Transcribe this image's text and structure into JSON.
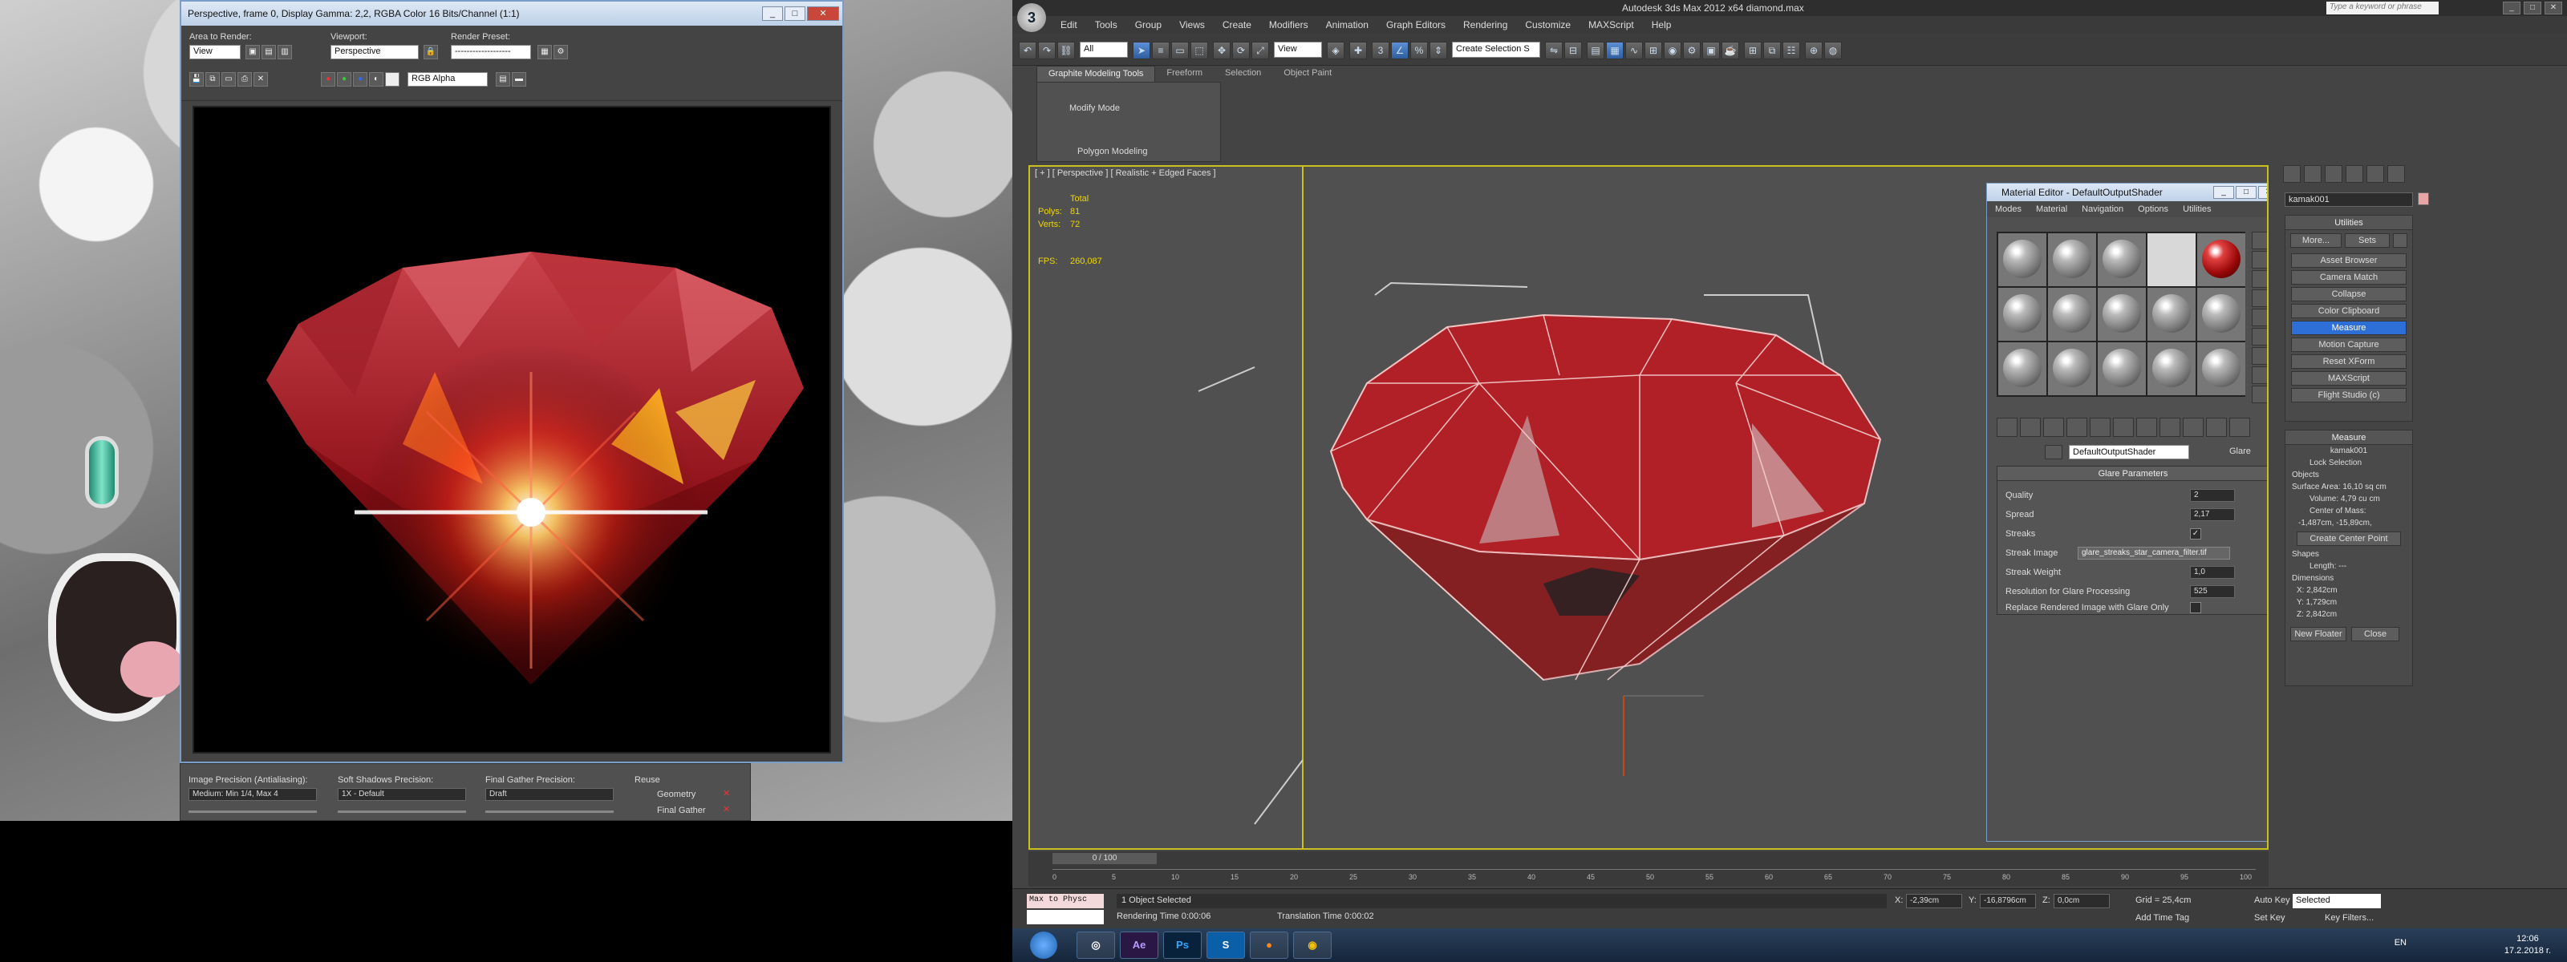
{
  "frame_buffer": {
    "title": "Perspective, frame 0, Display Gamma: 2,2, RGBA Color 16 Bits/Channel (1:1)",
    "area_to_render_label": "Area to Render:",
    "area_to_render_value": "View",
    "viewport_label": "Viewport:",
    "viewport_value": "Perspective",
    "render_preset_label": "Render Preset:",
    "render_preset_value": "-------------------",
    "channel_value": "RGB Alpha",
    "win_min": "_",
    "win_max": "□",
    "win_close": "✕"
  },
  "render_panel": {
    "image_precision_label": "Image Precision (Antialiasing):",
    "image_precision_value": "Medium: Min 1/4, Max 4",
    "soft_shadows_label": "Soft Shadows Precision:",
    "soft_shadows_value": "1X - Default",
    "final_gather_label": "Final Gather Precision:",
    "final_gather_value": "Draft",
    "reuse_label": "Reuse",
    "geometry_label": "Geometry",
    "final_gather_check_label": "Final Gather"
  },
  "max": {
    "title": "Autodesk 3ds Max  2012 x64        diamond.max",
    "search_placeholder": "Type a keyword or phrase",
    "menu": [
      "Edit",
      "Tools",
      "Group",
      "Views",
      "Create",
      "Modifiers",
      "Animation",
      "Graph Editors",
      "Rendering",
      "Customize",
      "MAXScript",
      "Help"
    ],
    "selection_filter": "All",
    "view_select": "View",
    "create_selection": "Create Selection S",
    "ribbon_tabs": [
      "Graphite Modeling Tools",
      "Freeform",
      "Selection",
      "Object Paint"
    ],
    "modify_mode": "Modify Mode",
    "polygon_modeling": "Polygon Modeling"
  },
  "viewport": {
    "label": "[ + ] [ Perspective ] [ Realistic + Edged Faces ]",
    "total_label": "Total",
    "polys_label": "Polys:",
    "polys_value": "81",
    "verts_label": "Verts:",
    "verts_value": "72",
    "fps_label": "FPS:",
    "fps_value": "260,087"
  },
  "material_editor": {
    "title": "Material Editor - DefaultOutputShader",
    "menu": [
      "Modes",
      "Material",
      "Navigation",
      "Options",
      "Utilities"
    ],
    "material_name": "DefaultOutputShader",
    "material_type": "Glare",
    "params_title": "Glare Parameters",
    "quality_label": "Quality",
    "quality_value": "2",
    "spread_label": "Spread",
    "spread_value": "2,17",
    "streaks_label": "Streaks",
    "streaks_value": "✓",
    "streak_image_label": "Streak Image",
    "streak_image_value": "glare_streaks_star_camera_filter.tif",
    "streak_weight_label": "Streak Weight",
    "streak_weight_value": "1,0",
    "resolution_label": "Resolution for Glare Processing",
    "resolution_value": "525",
    "replace_label": "Replace Rendered Image with Glare Only"
  },
  "command_panel": {
    "object_name": "kamak001",
    "utilities_title": "Utilities",
    "more_label": "More...",
    "sets_label": "Sets",
    "utilities": [
      "Asset Browser",
      "Camera Match",
      "Collapse",
      "Color Clipboard",
      "Measure",
      "Motion Capture",
      "Reset XForm",
      "MAXScript",
      "Flight Studio (c)"
    ],
    "measure_title": "Measure",
    "measure_object": "kamak001",
    "lock_selection": "Lock Selection",
    "objects_label": "Objects",
    "surface_area": "Surface Area: 16,10 sq cm",
    "volume": "Volume: 4,79 cu cm",
    "center_of_mass_label": "Center of Mass:",
    "center_of_mass": "-1,487cm, -15,89cm,",
    "create_center_point": "Create Center Point",
    "shapes_label": "Shapes",
    "length": "Length: ---",
    "dimensions_label": "Dimensions",
    "dim_x": "X:  2,842cm",
    "dim_y": "Y:  1,729cm",
    "dim_z": "Z:  2,842cm",
    "new_floater": "New Floater",
    "close": "Close"
  },
  "timeline": {
    "frame": "0 / 100",
    "ticks": [
      "0",
      "5",
      "10",
      "15",
      "20",
      "25",
      "30",
      "35",
      "40",
      "45",
      "50",
      "55",
      "60",
      "65",
      "70",
      "75",
      "80",
      "85",
      "90",
      "95",
      "100"
    ]
  },
  "status": {
    "maxscript_line": "Max to Physc",
    "selected": "1 Object Selected",
    "render_time": "Rendering Time  0:00:06",
    "translation_time": "Translation Time  0:00:02",
    "x_label": "X:",
    "x_value": "-2,39cm",
    "y_label": "Y:",
    "y_value": "-16,8796cm",
    "z_label": "Z:",
    "z_value": "0,0cm",
    "grid": "Grid = 25,4cm",
    "add_time_tag": "Add Time Tag",
    "auto_key": "Auto Key",
    "auto_key_select": "Selected",
    "set_key": "Set Key",
    "key_filters": "Key Filters..."
  },
  "taskbar": {
    "apps": [
      "Ae",
      "Ps",
      "S"
    ],
    "lang": "EN",
    "time": "12:06",
    "date": "17.2.2018 r."
  }
}
